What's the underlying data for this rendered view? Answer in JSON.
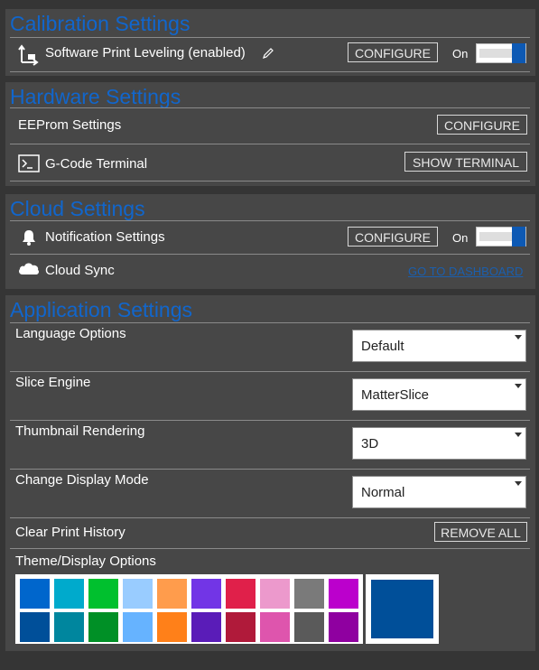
{
  "calibration": {
    "title": "Calibration Settings",
    "print_leveling_label": "Software Print Leveling (enabled)",
    "configure_label": "CONFIGURE",
    "toggle_label": "On",
    "toggle_on": true
  },
  "hardware": {
    "title": "Hardware Settings",
    "eeprom_label": "EEProm Settings",
    "eeprom_button": "CONFIGURE",
    "gcode_label": "G-Code Terminal",
    "gcode_button": "SHOW TERMINAL"
  },
  "cloud": {
    "title": "Cloud Settings",
    "notification_label": "Notification Settings",
    "notification_button": "CONFIGURE",
    "toggle_label": "On",
    "toggle_on": true,
    "sync_label": "Cloud Sync",
    "sync_link": "GO TO DASHBOARD"
  },
  "application": {
    "title": "Application Settings",
    "language": {
      "label": "Language Options",
      "value": "Default"
    },
    "slice_engine": {
      "label": "Slice Engine",
      "value": "MatterSlice"
    },
    "thumbnail": {
      "label": "Thumbnail Rendering",
      "value": "3D"
    },
    "display_mode": {
      "label": "Change Display Mode",
      "value": "Normal"
    },
    "clear_history": {
      "label": "Clear Print History",
      "button": "REMOVE ALL"
    },
    "theme": {
      "label": "Theme/Display Options",
      "row1": [
        "#0066cc",
        "#00aacc",
        "#00c02e",
        "#99ccff",
        "#ff9c4c",
        "#7235e6",
        "#e0204a",
        "#ec99cc",
        "#7a7a7a",
        "#bb00cc"
      ],
      "row2": [
        "#004f99",
        "#00869e",
        "#009026",
        "#66b3ff",
        "#ff8019",
        "#5a1cb8",
        "#b01a3a",
        "#de55ad",
        "#5a5a5a",
        "#8f00a0"
      ],
      "selected_color": "#004f99"
    }
  }
}
